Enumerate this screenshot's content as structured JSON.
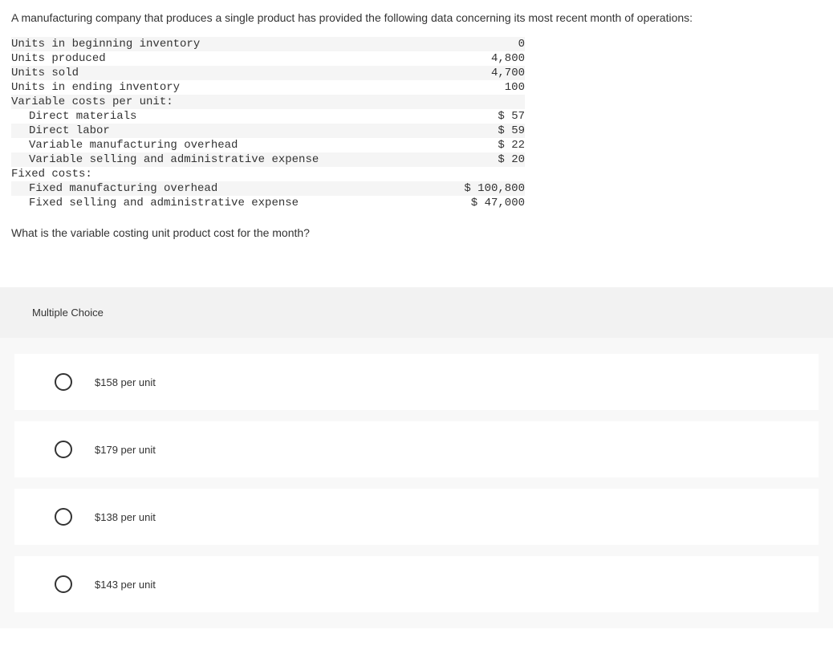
{
  "intro": "A manufacturing company that produces a single product has provided the following data concerning its most recent month of operations:",
  "rows": [
    {
      "label": "Units in beginning inventory",
      "value": "0",
      "indent": 0
    },
    {
      "label": "Units produced",
      "value": "4,800",
      "indent": 0
    },
    {
      "label": "Units sold",
      "value": "4,700",
      "indent": 0
    },
    {
      "label": "Units in ending inventory",
      "value": "100",
      "indent": 0
    },
    {
      "label": "Variable costs per unit:",
      "value": "",
      "indent": 0
    },
    {
      "label": "Direct materials",
      "value": "$ 57",
      "indent": 1
    },
    {
      "label": "Direct labor",
      "value": "$ 59",
      "indent": 1
    },
    {
      "label": "Variable manufacturing overhead",
      "value": "$ 22",
      "indent": 1
    },
    {
      "label": "Variable selling and administrative expense",
      "value": "$ 20",
      "indent": 1
    },
    {
      "label": "Fixed costs:",
      "value": "",
      "indent": 0
    },
    {
      "label": "Fixed manufacturing overhead",
      "value": "$ 100,800",
      "indent": 1
    },
    {
      "label": "Fixed selling and administrative expense",
      "value": "$ 47,000",
      "indent": 1
    }
  ],
  "question": "What is the variable costing unit product cost for the month?",
  "mc_header": "Multiple Choice",
  "choices": [
    "$158 per unit",
    "$179 per unit",
    "$138 per unit",
    "$143 per unit"
  ]
}
